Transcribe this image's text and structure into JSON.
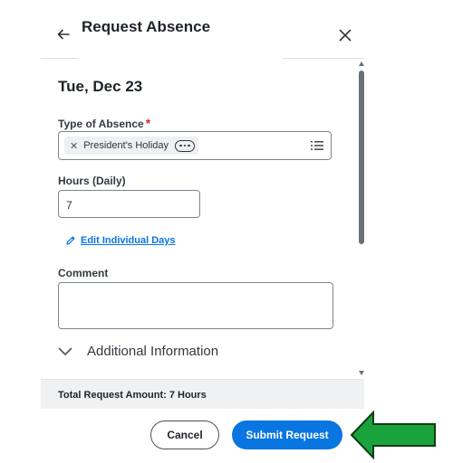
{
  "header": {
    "title": "Request Absence"
  },
  "form": {
    "date": "Tue, Dec 23",
    "type_label": "Type of Absence",
    "required_mark": "*",
    "type_value": "President's Holiday",
    "hours_label": "Hours (Daily)",
    "hours_value": "7",
    "edit_days_link": "Edit Individual Days",
    "comment_label": "Comment",
    "comment_value": "",
    "additional_info": "Additional Information"
  },
  "footer": {
    "total": "Total Request Amount: 7 Hours",
    "cancel_label": "Cancel",
    "submit_label": "Submit Request"
  },
  "colors": {
    "accent": "#0875e1",
    "required": "#de2e21",
    "arrow_fill": "#1aa23c",
    "arrow_stroke": "#0c3d14"
  },
  "icons": [
    "arrow-left-icon",
    "close-icon",
    "list-icon",
    "pencil-icon",
    "chevron-down-icon",
    "green-arrow-icon"
  ]
}
